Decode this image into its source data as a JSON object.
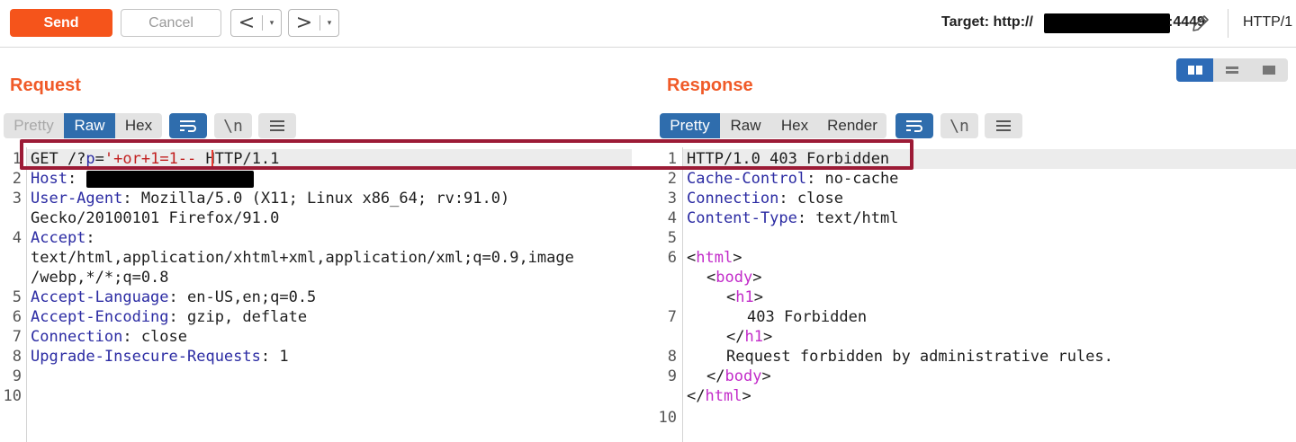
{
  "toolbar": {
    "send_label": "Send",
    "cancel_label": "Cancel",
    "back_glyph": "<",
    "forward_glyph": ">",
    "dropdown_glyph": "▾",
    "target_label": "Target: http://",
    "target_port": ":4449",
    "http_version": "HTTP/1"
  },
  "request": {
    "title": "Request",
    "tabs": [
      "Pretty",
      "Raw",
      "Hex"
    ],
    "active_tab": "Raw",
    "newline_label": "\\n",
    "line_numbers": [
      "1",
      "2",
      "3",
      "",
      "4",
      "",
      "",
      "5",
      "6",
      "7",
      "8",
      "9",
      "10"
    ],
    "lines": {
      "l1_method": "GET /?",
      "l1_param": "p",
      "l1_eq": "=",
      "l1_payload": "'+or+1=1--",
      "l1_proto": " HTTP/1.1",
      "l2_key": "Host",
      "l2_sep": ": ",
      "l3_key": "User-Agent",
      "l3_val": ": Mozilla/5.0 (X11; Linux x86_64; rv:91.0)",
      "l3_cont": "Gecko/20100101 Firefox/91.0",
      "l4_key": "Accept",
      "l4_sep": ":",
      "l4_cont1": "text/html,application/xhtml+xml,application/xml;q=0.9,image",
      "l4_cont2": "/webp,*/*;q=0.8",
      "l5_key": "Accept-Language",
      "l5_val": ": en-US,en;q=0.5",
      "l6_key": "Accept-Encoding",
      "l6_val": ": gzip, deflate",
      "l7_key": "Connection",
      "l7_val": ": close",
      "l8_key": "Upgrade-Insecure-Requests",
      "l8_val": ": 1"
    }
  },
  "response": {
    "title": "Response",
    "tabs": [
      "Pretty",
      "Raw",
      "Hex",
      "Render"
    ],
    "active_tab": "Pretty",
    "newline_label": "\\n",
    "line_numbers": [
      "1",
      "2",
      "3",
      "4",
      "5",
      "6",
      "",
      "",
      "7",
      "",
      "8",
      "9",
      "",
      "10"
    ],
    "lines": {
      "l1": "HTTP/1.0 403 Forbidden",
      "l2_key": "Cache-Control",
      "l2_val": ": no-cache",
      "l3_key": "Connection",
      "l3_val": ": close",
      "l4_key": "Content-Type",
      "l4_val": ": text/html",
      "html_open_lt": "<",
      "html_tag": "html",
      "gt": ">",
      "body_tag": "body",
      "h1_tag": "h1",
      "close_lt": "</",
      "h1_text": "403 Forbidden",
      "body_text": "Request forbidden by administrative rules."
    }
  },
  "colors": {
    "accent": "#f5541b",
    "title": "#f05a28",
    "active_tab": "#2f6dad",
    "highlight_border": "#9c1b36",
    "header_key": "#2b2ba3",
    "html_tag": "#c22bc9",
    "payload": "#c22020"
  },
  "icons": {
    "pencil": "pencil-icon",
    "wrap": "word-wrap-icon",
    "menu": "hamburger-menu-icon",
    "layout": [
      "split-horizontal-icon",
      "split-vertical-icon",
      "single-pane-icon"
    ]
  }
}
